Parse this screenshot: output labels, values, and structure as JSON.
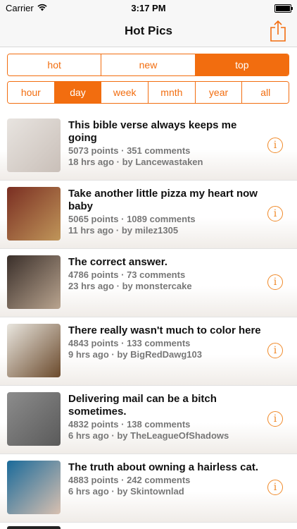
{
  "status_bar": {
    "carrier": "Carrier",
    "time": "3:17 PM"
  },
  "nav": {
    "title": "Hot Pics",
    "share_icon": "share-icon"
  },
  "sort_segments": [
    {
      "label": "hot",
      "active": false
    },
    {
      "label": "new",
      "active": false
    },
    {
      "label": "top",
      "active": true
    }
  ],
  "time_segments": [
    {
      "label": "hour",
      "active": false
    },
    {
      "label": "day",
      "active": true
    },
    {
      "label": "week",
      "active": false
    },
    {
      "label": "mnth",
      "active": false
    },
    {
      "label": "year",
      "active": false
    },
    {
      "label": "all",
      "active": false
    }
  ],
  "accent_color": "#f26d0f",
  "posts": [
    {
      "title": "This bible verse always keeps me going",
      "points": "5073 points · 351 comments",
      "time": "18 hrs ago · by Lancewastaken",
      "thumb_colors": [
        "#e8e4e0",
        "#c9bfb8"
      ]
    },
    {
      "title": "Take another little pizza my heart now baby",
      "points": "5065 points · 1089 comments",
      "time": "11 hrs ago · by milez1305",
      "thumb_colors": [
        "#7a2e22",
        "#c0965a"
      ]
    },
    {
      "title": "The correct answer.",
      "points": "4786 points · 73 comments",
      "time": "23 hrs ago · by monstercake",
      "thumb_colors": [
        "#3a2f2a",
        "#b9a48f"
      ]
    },
    {
      "title": "There really wasn't much to color here",
      "points": "4843 points · 133 comments",
      "time": "9 hrs ago · by BigRedDawg103",
      "thumb_colors": [
        "#e9e6df",
        "#6b4a2c"
      ]
    },
    {
      "title": "Delivering mail can be a bitch sometimes.",
      "points": "4832 points · 138 comments",
      "time": "6 hrs ago · by TheLeagueOfShadows",
      "thumb_colors": [
        "#8c8c8c",
        "#5a5a5a"
      ]
    },
    {
      "title": "The truth about owning a hairless cat.",
      "points": "4883 points · 242 comments",
      "time": "6 hrs ago · by Skintownlad",
      "thumb_colors": [
        "#1a6a9a",
        "#d8c0b0"
      ]
    }
  ]
}
